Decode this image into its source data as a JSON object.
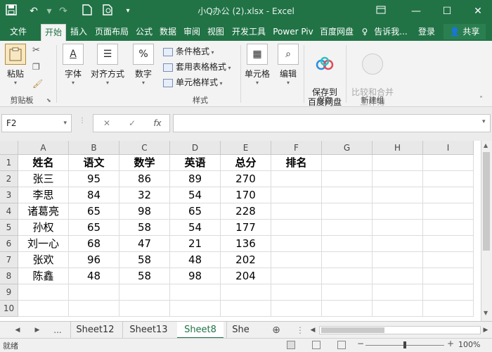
{
  "window": {
    "title": "小Q办公 (2).xlsx - Excel",
    "quick_access": [
      "save-icon",
      "undo-icon",
      "redo-icon",
      "new-icon",
      "print-preview-icon",
      "customize-icon"
    ],
    "controls": [
      "restore-ribbon-icon",
      "minimize-icon",
      "maximize-icon",
      "close-icon"
    ]
  },
  "tabs": [
    "文件",
    "开始",
    "插入",
    "页面布局",
    "公式",
    "数据",
    "审阅",
    "视图",
    "开发工具",
    "Power Piv",
    "百度网盘"
  ],
  "active_tab": "开始",
  "tell_me": "告诉我...",
  "login": "登录",
  "share": "共享",
  "ribbon": {
    "clipboard": {
      "paste": "粘贴",
      "label": "剪贴板"
    },
    "font": "字体",
    "alignment": "对齐方式",
    "number": "数字",
    "number_symbol": "%",
    "styles": {
      "conditional": "条件格式",
      "table": "套用表格格式",
      "cell_style": "单元格样式",
      "label": "样式"
    },
    "cells": "单元格",
    "editing": "编辑",
    "save": {
      "button": "保存到\n百度网盘",
      "label": "保存"
    },
    "compare": {
      "button": "比较和合并\n工作簿",
      "label": "新建组"
    }
  },
  "formula_bar": {
    "name_box": "F2",
    "cancel": "✕",
    "enter": "✓",
    "fx": "fx",
    "value": ""
  },
  "grid": {
    "columns": [
      "A",
      "B",
      "C",
      "D",
      "E",
      "F",
      "G",
      "H",
      "I"
    ],
    "rows": [
      "1",
      "2",
      "3",
      "4",
      "5",
      "6",
      "7",
      "8",
      "9",
      "10"
    ],
    "data": [
      [
        "姓名",
        "语文",
        "数学",
        "英语",
        "总分",
        "排名"
      ],
      [
        "张三",
        "95",
        "86",
        "89",
        "270",
        ""
      ],
      [
        "李思",
        "84",
        "32",
        "54",
        "170",
        ""
      ],
      [
        "诸葛亮",
        "65",
        "98",
        "65",
        "228",
        ""
      ],
      [
        "孙权",
        "65",
        "58",
        "54",
        "177",
        ""
      ],
      [
        "刘一心",
        "68",
        "47",
        "21",
        "136",
        ""
      ],
      [
        "张欢",
        "96",
        "58",
        "48",
        "202",
        ""
      ],
      [
        "陈鑫",
        "48",
        "58",
        "98",
        "204",
        ""
      ]
    ]
  },
  "sheets": [
    "Sheet12",
    "Sheet13",
    "Sheet8",
    "She"
  ],
  "active_sheet": "Sheet8",
  "sheet_nav": {
    "ellipsis": "..."
  },
  "status": {
    "ready": "就绪",
    "zoom": "100%"
  },
  "colors": {
    "accent": "#217346"
  }
}
